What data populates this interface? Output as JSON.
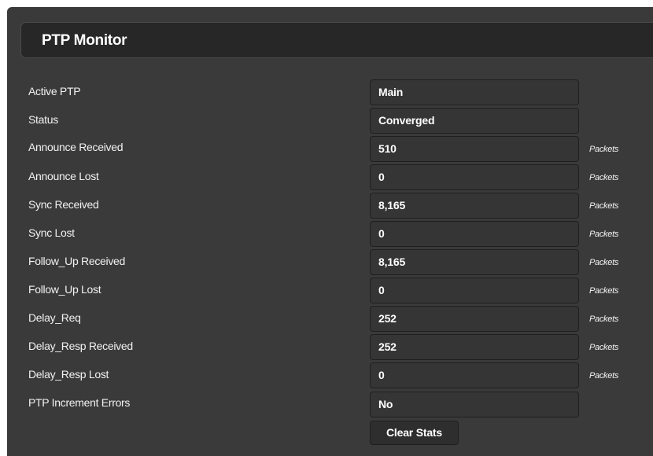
{
  "header": {
    "title": "PTP Monitor"
  },
  "rows": [
    {
      "label": "Active PTP",
      "value": "Main",
      "unit": ""
    },
    {
      "label": "Status",
      "value": "Converged",
      "unit": ""
    },
    {
      "label": "Announce Received",
      "value": "510",
      "unit": "Packets"
    },
    {
      "label": "Announce Lost",
      "value": "0",
      "unit": "Packets"
    },
    {
      "label": "Sync Received",
      "value": "8,165",
      "unit": "Packets"
    },
    {
      "label": "Sync Lost",
      "value": "0",
      "unit": "Packets"
    },
    {
      "label": "Follow_Up Received",
      "value": "8,165",
      "unit": "Packets"
    },
    {
      "label": "Follow_Up Lost",
      "value": "0",
      "unit": "Packets"
    },
    {
      "label": "Delay_Req",
      "value": "252",
      "unit": "Packets"
    },
    {
      "label": "Delay_Resp Received",
      "value": "252",
      "unit": "Packets"
    },
    {
      "label": "Delay_Resp Lost",
      "value": "0",
      "unit": "Packets"
    },
    {
      "label": "PTP Increment Errors",
      "value": "No",
      "unit": ""
    }
  ],
  "actions": {
    "clear_stats_label": "Clear Stats"
  }
}
